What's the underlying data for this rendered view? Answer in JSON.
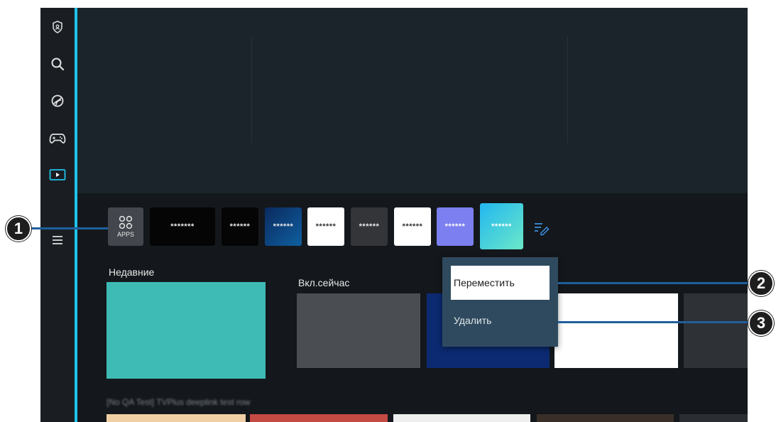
{
  "nav": {
    "items": [
      {
        "name": "privacy-shield-icon",
        "top": 0
      },
      {
        "name": "search-icon"
      },
      {
        "name": "ambient-icon"
      },
      {
        "name": "game-icon"
      },
      {
        "name": "media-icon"
      },
      {
        "name": "menu-icon"
      }
    ]
  },
  "apps": {
    "apps_label": "APPS",
    "tiles": [
      "*******",
      "******",
      "******",
      "******",
      "******",
      "******",
      "******",
      "******"
    ]
  },
  "sections": {
    "recent_title": "Недавние",
    "now_title": "Вкл.сейчас",
    "row_title": "[No QA Test] TVPlus deeplink test row"
  },
  "context_menu": {
    "move_label": "Переместить",
    "delete_label": "Удалить"
  },
  "callouts": {
    "one": "1",
    "two": "2",
    "three": "3"
  },
  "colors": {
    "accent_line": "#1ec3ea",
    "callout_line": "#1f5f9e",
    "recent_card": "#3dbbb4",
    "menu_bg": "#2f4a5e"
  }
}
